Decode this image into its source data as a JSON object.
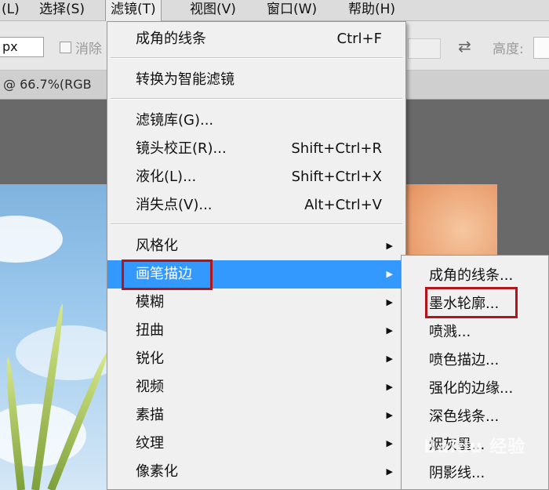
{
  "menubar": {
    "items": [
      {
        "label": "(L)"
      },
      {
        "label": "选择(S)"
      },
      {
        "label": "滤镜(T)"
      },
      {
        "label": "视图(V)"
      },
      {
        "label": "窗口(W)"
      },
      {
        "label": "帮助(H)"
      }
    ]
  },
  "options": {
    "unit_value": "px",
    "checkbox_label": "消除",
    "height_label": "高度:"
  },
  "document": {
    "tab_label": "@ 66.7%(RGB"
  },
  "filter_menu": {
    "items": [
      {
        "label": "成角的线条",
        "shortcut": "Ctrl+F"
      },
      {
        "label": "转换为智能滤镜",
        "shortcut": ""
      },
      {
        "label": "滤镜库(G)...",
        "shortcut": ""
      },
      {
        "label": "镜头校正(R)...",
        "shortcut": "Shift+Ctrl+R"
      },
      {
        "label": "液化(L)...",
        "shortcut": "Shift+Ctrl+X"
      },
      {
        "label": "消失点(V)...",
        "shortcut": "Alt+Ctrl+V"
      },
      {
        "label": "风格化",
        "shortcut": ""
      },
      {
        "label": "画笔描边",
        "shortcut": ""
      },
      {
        "label": "模糊",
        "shortcut": ""
      },
      {
        "label": "扭曲",
        "shortcut": ""
      },
      {
        "label": "锐化",
        "shortcut": ""
      },
      {
        "label": "视频",
        "shortcut": ""
      },
      {
        "label": "素描",
        "shortcut": ""
      },
      {
        "label": "纹理",
        "shortcut": ""
      },
      {
        "label": "像素化",
        "shortcut": ""
      }
    ]
  },
  "brush_strokes_submenu": {
    "items": [
      {
        "label": "成角的线条..."
      },
      {
        "label": "墨水轮廓..."
      },
      {
        "label": "喷溅..."
      },
      {
        "label": "喷色描边..."
      },
      {
        "label": "强化的边缘..."
      },
      {
        "label": "深色线条..."
      },
      {
        "label": "烟灰墨..."
      },
      {
        "label": "阴影线..."
      }
    ]
  },
  "watermark": "Baidu 经验",
  "colors": {
    "highlight": "#3399ff",
    "annotation_red": "#b3141c"
  }
}
